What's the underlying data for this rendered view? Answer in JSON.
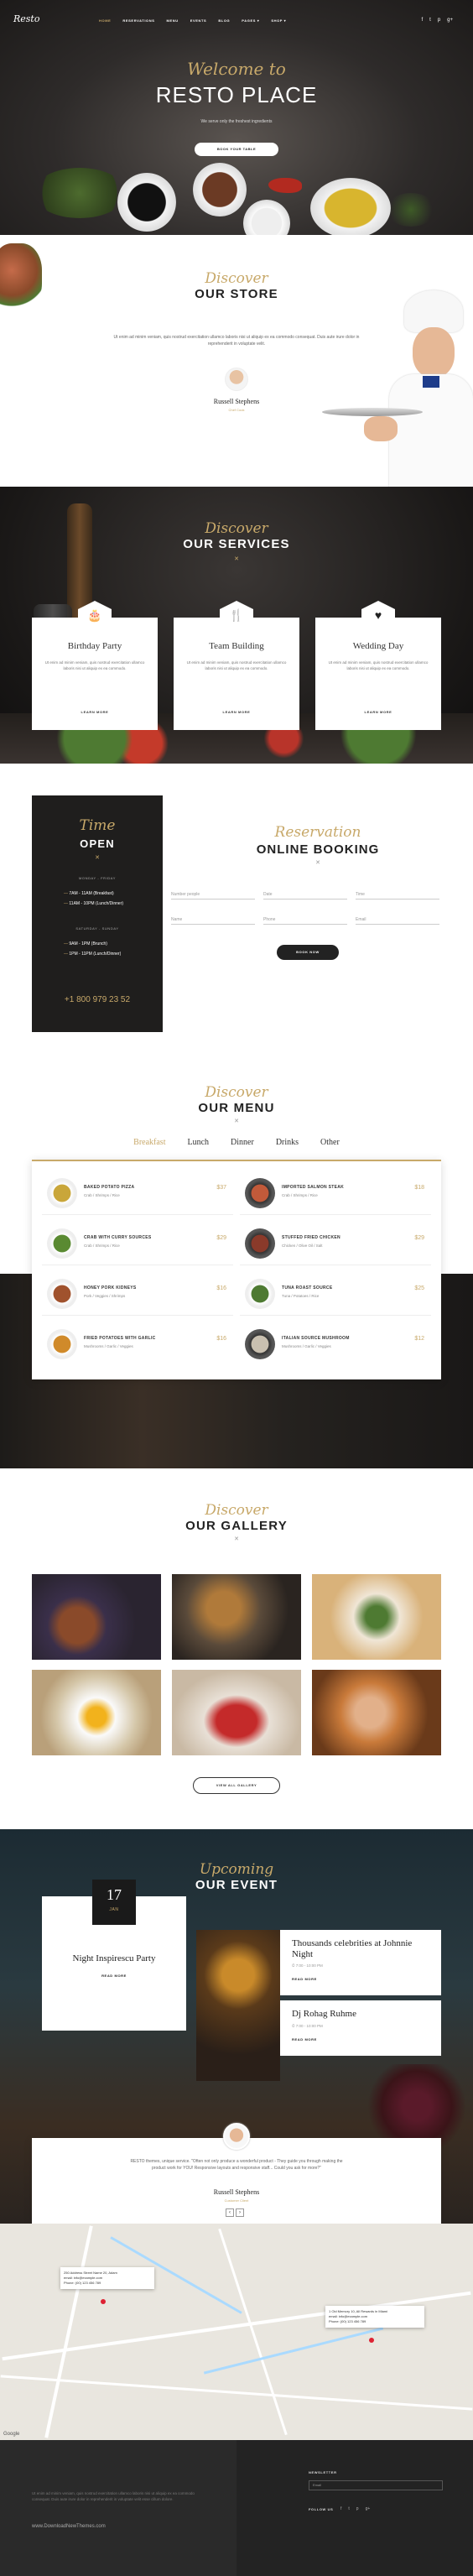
{
  "nav": {
    "logo": "Resto",
    "items": [
      "HOME",
      "RESERVATIONS",
      "MENU",
      "EVENTS",
      "BLOG",
      "PAGES ▾",
      "SHOP ▾"
    ],
    "active_index": 0,
    "social": [
      "f",
      "t",
      "p",
      "g+"
    ]
  },
  "hero": {
    "welcome": "Welcome to",
    "title": "RESTO PLACE",
    "subtitle": "We serve only the freshest ingredients",
    "button": "BOOK YOUR TABLE"
  },
  "store": {
    "script": "Discover",
    "title": "OUR STORE",
    "text": "Ut enim ad minim veniam, quis nostrud exercitation ullamco laboris nisi ut aliquip ex ea commodo consequat. Duis aute irure dolor in reprehenderit in voluptate velit.",
    "chef_name": "Russell Stephens",
    "chef_role": "Chef Cook"
  },
  "services": {
    "script": "Discover",
    "title": "OUR SERVICES",
    "items": [
      {
        "icon": "cake-icon",
        "glyph": "🎂",
        "name": "Birthday Party",
        "desc": "Ut enim ad minim veniam, quis nostrud exercitation ullamco laboris nisi ut aliquip ex ea commodo.",
        "more": "LEARN MORE"
      },
      {
        "icon": "cutlery-icon",
        "glyph": "🍴",
        "name": "Team Building",
        "desc": "Ut enim ad minim veniam, quis nostrud exercitation ullamco laboris nisi ut aliquip ex ea commodo.",
        "more": "LEARN MORE"
      },
      {
        "icon": "heart-icon",
        "glyph": "♥",
        "name": "Wedding Day",
        "desc": "Ut enim ad minim veniam, quis nostrud exercitation ullamco laboris nisi ut aliquip ex ea commodo.",
        "more": "LEARN MORE"
      }
    ]
  },
  "hours": {
    "script": "Time",
    "title": "OPEN",
    "weekday_label": "MONDAY - FRIDAY",
    "weekday_rows": [
      "7AM - 11AM (Breakfast)",
      "11AM - 10PM (Lunch/Dinner)"
    ],
    "weekend_label": "SATURDAY - SUNDAY",
    "weekend_rows": [
      "9AM - 1PM (Brunch)",
      "1PM - 11PM (Lunch/Dinner)"
    ],
    "phone": "+1 800 979 23 52"
  },
  "booking": {
    "script": "Reservation",
    "title": "ONLINE BOOKING",
    "fields": [
      "Number people",
      "Date",
      "Time",
      "Name",
      "Phone",
      "Email"
    ],
    "button": "BOOK NOW"
  },
  "menu": {
    "script": "Discover",
    "title": "OUR MENU",
    "tabs": [
      "Breakfast",
      "Lunch",
      "Dinner",
      "Drinks",
      "Other"
    ],
    "active_tab": 0,
    "dishes": [
      {
        "name": "BAKED POTATO PIZZA",
        "desc": "Crab / Shrimps / Rice",
        "price": "$37"
      },
      {
        "name": "IMPORTED SALMON STEAK",
        "desc": "Crab / Shrimps / Rice",
        "price": "$18"
      },
      {
        "name": "CRAB WITH CURRY SOURCES",
        "desc": "Crab / Shrimps / Rice",
        "price": "$29"
      },
      {
        "name": "STUFFED FRIED CHICKEN",
        "desc": "Chicken / Olive Oil / Salt",
        "price": "$29"
      },
      {
        "name": "HONEY PORK KIDNEYS",
        "desc": "Pork / Veggies / Shrimps",
        "price": "$16"
      },
      {
        "name": "TUNA ROAST SOURCE",
        "desc": "Tuna / Potatoes / Rice",
        "price": "$25"
      },
      {
        "name": "FRIED POTATOES WITH GARLIC",
        "desc": "Mushrooms / Garlic / Veggies",
        "price": "$16"
      },
      {
        "name": "ITALIAN SOURCE MUSHROOM",
        "desc": "Mushrooms / Garlic / Veggies",
        "price": "$12"
      }
    ]
  },
  "gallery": {
    "script": "Discover",
    "title": "OUR GALLERY",
    "button": "VIEW ALL GALLERY"
  },
  "event": {
    "script": "Upcoming",
    "title": "OUR EVENT",
    "main": {
      "day": "17",
      "month": "JAN",
      "title": "Night Inspirescu Party",
      "more": "READ MORE"
    },
    "side": [
      {
        "title": "Thousands celebrities at Johnnie Night",
        "meta": "⏱ 7:00 - 10:00 PM",
        "more": "READ MORE"
      },
      {
        "title": "Dj Rohag Ruhme",
        "meta": "⏱ 7:00 - 10:00 PM",
        "more": "READ MORE"
      }
    ],
    "testimonial": {
      "quote": "RESTO themes, unique service. \"Often not only produce a wonderful product - They guide you through making the product work for YOU! Responsive layouts and responsive staff... Could you ask for more?\"",
      "name": "Russell Stephens",
      "role": "Customer Client"
    }
  },
  "map": {
    "card_left": [
      "250 Address Street Name 20, Adam",
      "email: info@example.com",
      "Phone: (00) 123 456 789"
    ],
    "card_right": [
      "1 Old Memory 10, All Rewards in Miami",
      "email: info@example.com",
      "Phone: (00) 123 456 789"
    ],
    "google": "Google"
  },
  "footer": {
    "text": "Ut enim ad minim veniam, quis nostrud exercitation ullamco laboris nisi ut aliquip ex ea commodo consequat. Duis aute irure dolor in reprehenderit in voluptate velit esse cillum dolore.",
    "url": "www.DownloadNewThemes.com",
    "newsletter_label": "NEWSLETTER",
    "newsletter_placeholder": "Email",
    "follow_label": "FOLLOW US",
    "social": [
      "f",
      "t",
      "p",
      "g+"
    ]
  },
  "colors": {
    "accent": "#c8a96a",
    "dark": "#1f1e1d"
  }
}
